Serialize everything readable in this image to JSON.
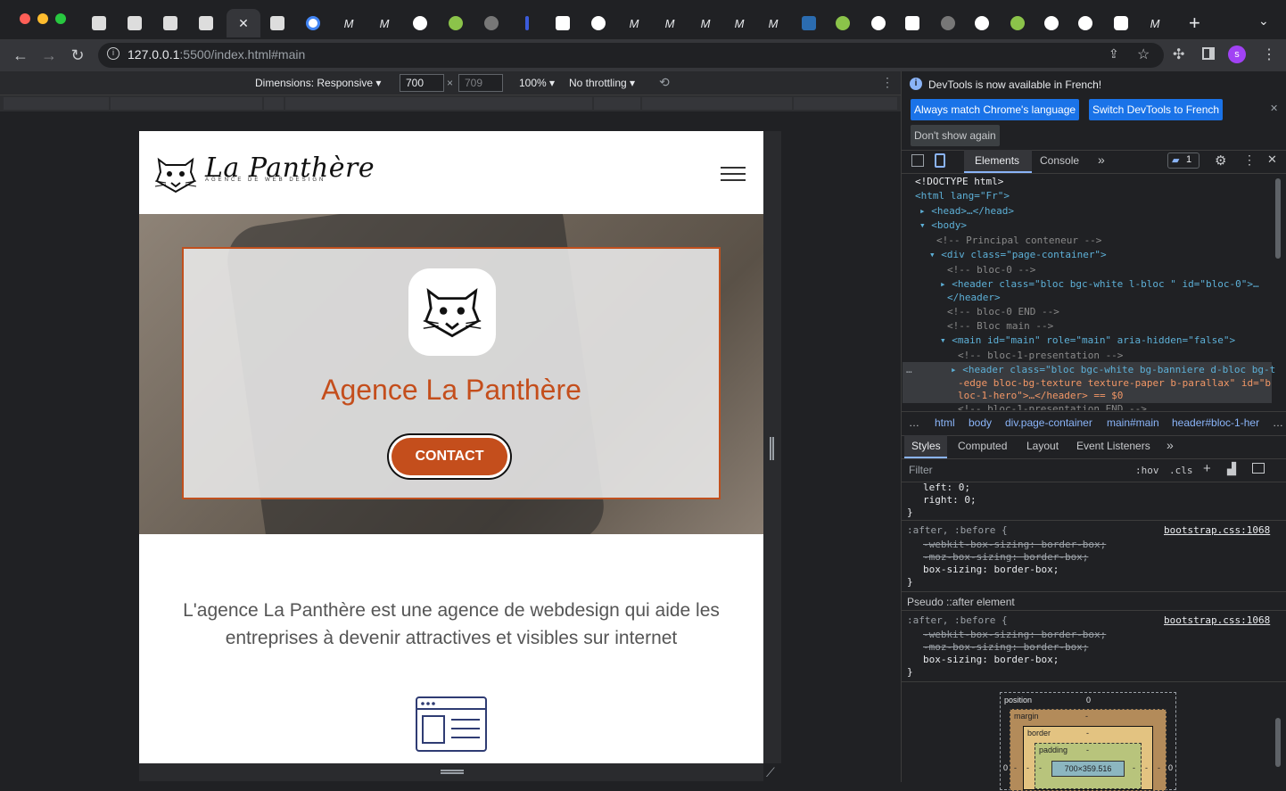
{
  "browser": {
    "url_host": "127.0.0.1",
    "url_path": ":5500/index.html#main",
    "new_tab": "+",
    "profile_initial": "s"
  },
  "device_toolbar": {
    "dimensions_label": "Dimensions: Responsive",
    "width": "700",
    "height": "709",
    "times": "×",
    "zoom": "100%",
    "throttle": "No throttling"
  },
  "site": {
    "brand": "La Panthère",
    "brand_sub": "AGENCE DE WEB DESIGN",
    "hero_title": "Agence La Panthère",
    "contact_label": "CONTACT",
    "intro": "L'agence La Panthère est une agence de webdesign qui aide les entreprises à devenir attractives et visibles sur internet"
  },
  "devtools": {
    "info_text": "DevTools is now available in French!",
    "btn_match": "Always match Chrome's language",
    "btn_switch": "Switch DevTools to French",
    "btn_dont": "Don't show again",
    "tabs": {
      "elements": "Elements",
      "console": "Console",
      "more": "»",
      "issues": "1"
    },
    "dom": [
      "<!DOCTYPE html>",
      "<html lang=\"Fr\">",
      "<head>…</head>",
      "<body>",
      "<!-- Principal conteneur -->",
      "<div class=\"page-container\">",
      "<!-- bloc-0 -->",
      "<header class=\"bloc bgc-white l-bloc \" id=\"bloc-0\">…",
      "</header>",
      "<!-- bloc-0 END -->",
      "<!-- Bloc main -->",
      "<main id=\"main\" role=\"main\" aria-hidden=\"false\">",
      "<!-- bloc-1-presentation -->",
      "<header class=\"bloc bgc-white bg-banniere d-bloc bg-t",
      "-edge bloc-bg-texture texture-paper b-parallax\" id=\"b",
      "loc-1-hero\">…</header> == $0",
      "<!-- bloc-1-presentation END -->"
    ],
    "breadcrumbs": [
      "…",
      "html",
      "body",
      "div.page-container",
      "main#main",
      "header#bloc-1-her",
      "…"
    ],
    "style_tabs": {
      "styles": "Styles",
      "computed": "Computed",
      "layout": "Layout",
      "events": "Event Listeners",
      "more": "»"
    },
    "filter_placeholder": "Filter",
    "hov": ":hov",
    "cls": ".cls",
    "css_lines": {
      "left": "left: 0;",
      "right": "right: 0;",
      "close1": "}",
      "sel1": ":after, :before {",
      "src1": "bootstrap.css:1068",
      "wk1": "-webkit-box-sizing: border-box;",
      "moz1": "-moz-box-sizing: border-box;",
      "bs1": "box-sizing: border-box;",
      "close2": "}",
      "pseudo": "Pseudo ::after element",
      "sel2": ":after, :before {",
      "src2": "bootstrap.css:1068",
      "wk2": "-webkit-box-sizing: border-box;",
      "moz2": "-moz-box-sizing: border-box;",
      "bs2": "box-sizing: border-box;",
      "close3": "}"
    },
    "box_model": {
      "position": "position",
      "position_val": "0",
      "margin": "margin",
      "margin_val": "-",
      "border": "border",
      "border_val": "-",
      "padding": "padding",
      "padding_val": "-",
      "content": "700×359.516",
      "left_val": "0",
      "right_val": "0",
      "dash_l1": "-",
      "dash_l2": "-",
      "dash_l3": "-",
      "dash_r1": "-",
      "dash_r2": "-",
      "dash_r3": "-"
    }
  },
  "colors": {
    "accent": "#c44e1c",
    "devtools_blue": "#1a73e8"
  }
}
